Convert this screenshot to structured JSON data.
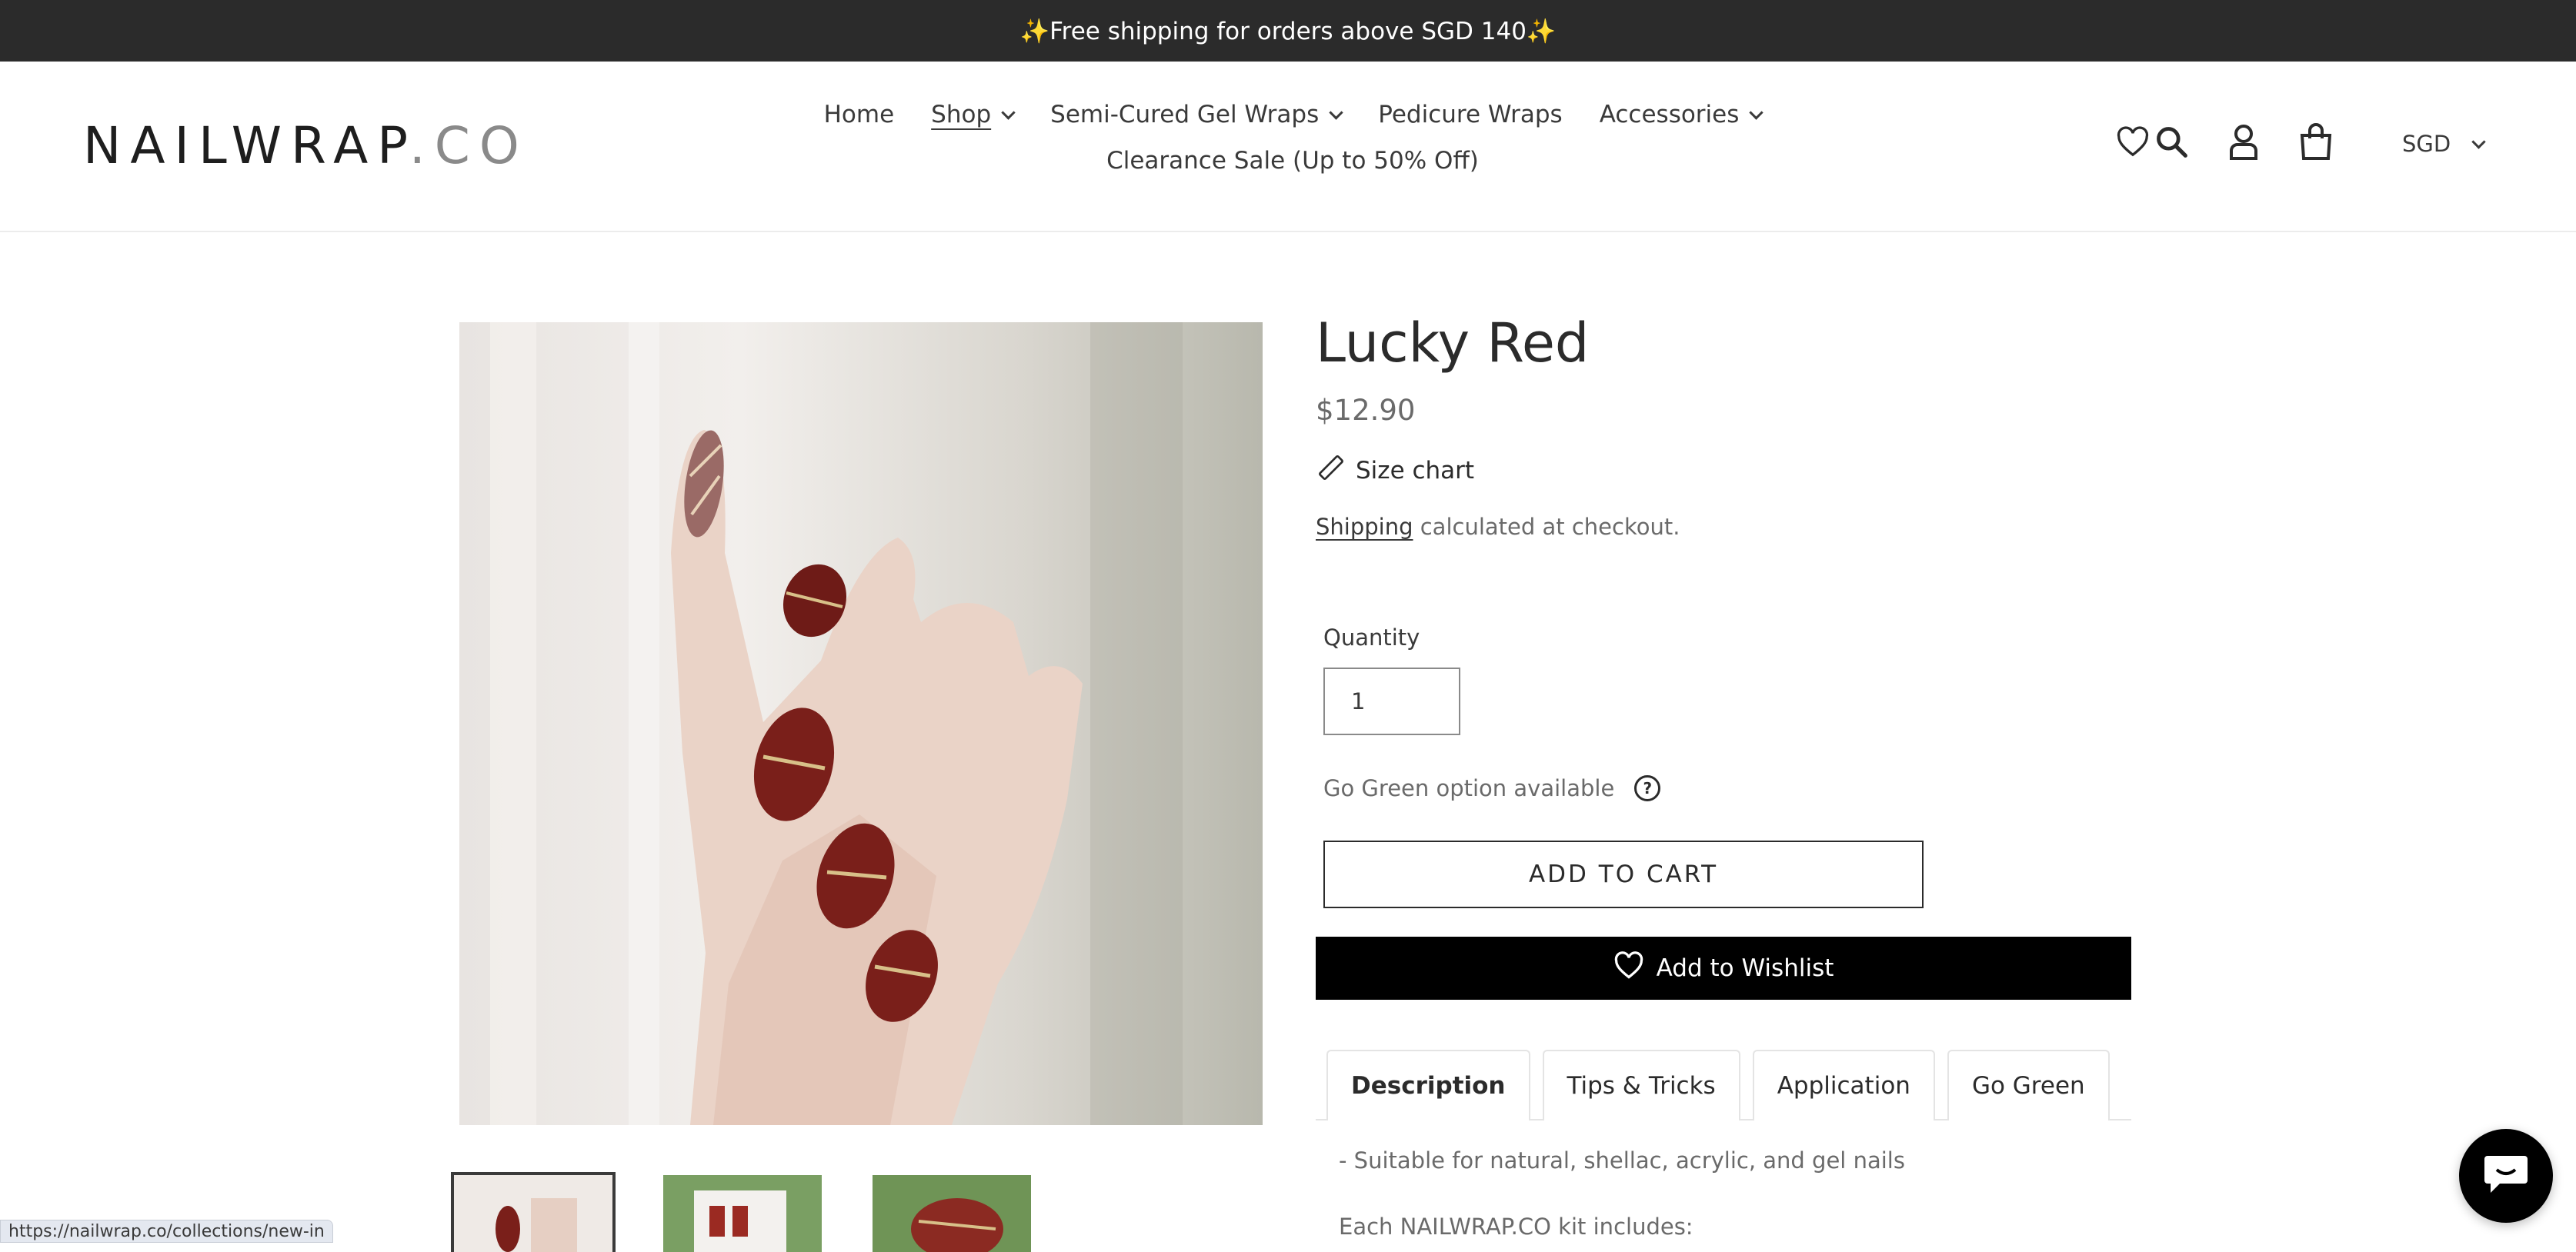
{
  "announcement": "✨Free shipping for orders above SGD 140✨",
  "header": {
    "logo_main": "NAILWRAP",
    "logo_suffix": ".CO",
    "nav": [
      {
        "label": "Home",
        "dropdown": false,
        "active": false
      },
      {
        "label": "Shop",
        "dropdown": true,
        "active": true
      },
      {
        "label": "Semi-Cured Gel Wraps",
        "dropdown": true,
        "active": false
      },
      {
        "label": "Pedicure Wraps",
        "dropdown": false,
        "active": false
      },
      {
        "label": "Accessories",
        "dropdown": true,
        "active": false
      },
      {
        "label": "Clearance Sale (Up to 50% Off)",
        "dropdown": false,
        "active": false
      }
    ],
    "icons": [
      "heart-icon",
      "search-icon",
      "account-icon",
      "cart-icon"
    ],
    "currency": "SGD"
  },
  "product": {
    "title": "Lucky Red",
    "price": "$12.90",
    "size_chart": "Size chart",
    "shipping_link": "Shipping",
    "shipping_rest": " calculated at checkout.",
    "quantity_label": "Quantity",
    "quantity_value": "1",
    "go_green": "Go Green option available",
    "help_symbol": "?",
    "add_to_cart": "ADD TO CART",
    "wishlist": "Add to Wishlist",
    "tabs": [
      {
        "label": "Description",
        "active": true
      },
      {
        "label": "Tips & Tricks",
        "active": false
      },
      {
        "label": "Application",
        "active": false
      },
      {
        "label": "Go Green",
        "active": false
      }
    ],
    "description": [
      "- Suitable for natural, shellac, acrylic, and gel nails",
      "Each NAILWRAP.CO kit includes:"
    ]
  },
  "status_bar_url": "https://nailwrap.co/collections/new-in",
  "colors": {
    "announcement_bg": "#2b2b2b",
    "wishlist_bg": "#000000",
    "nail_red": "#7a1f1a"
  }
}
